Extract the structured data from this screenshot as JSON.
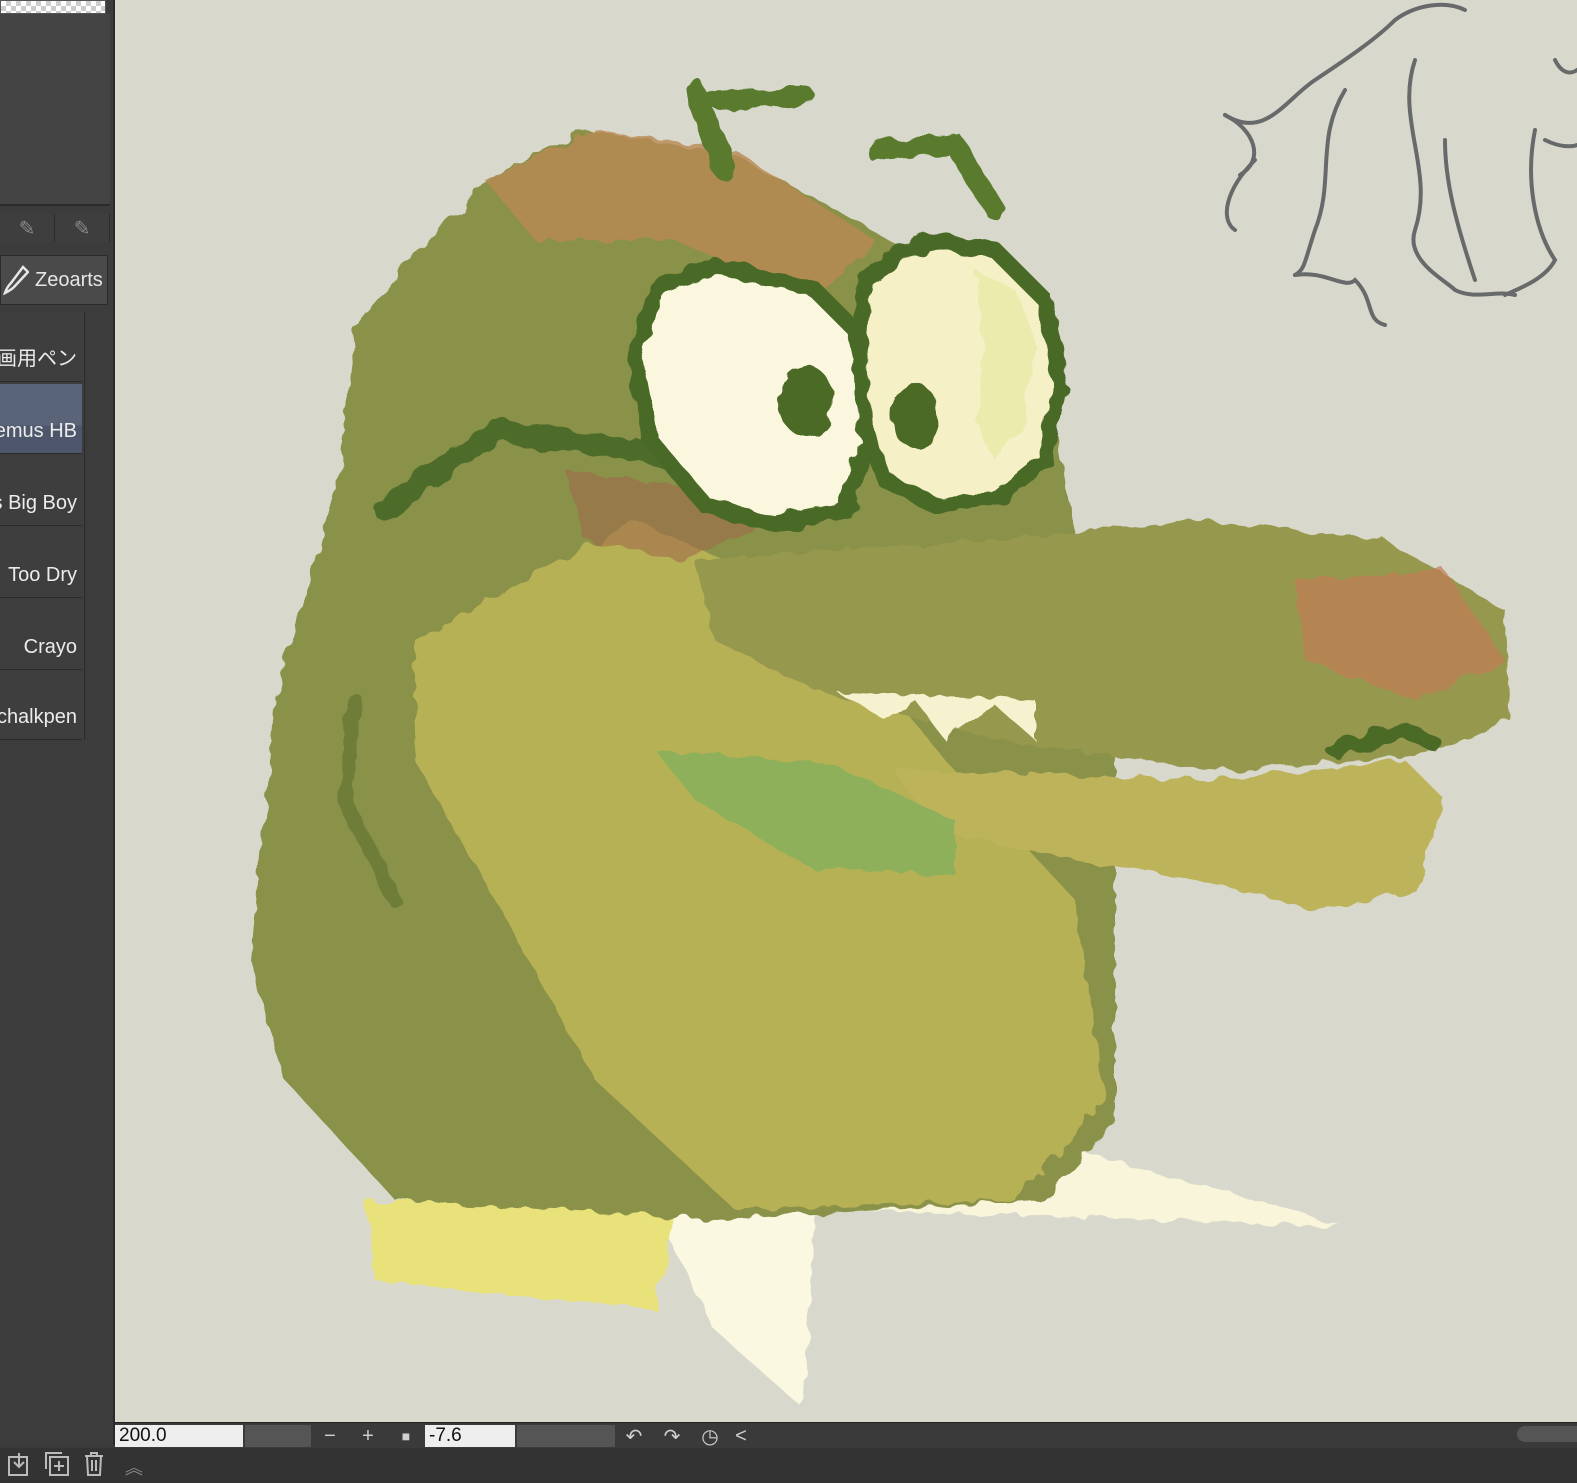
{
  "brush_set": {
    "label": "Zeoarts"
  },
  "brush_list": {
    "items": [
      {
        "label": "画用ペン",
        "selected": false
      },
      {
        "label": "emus HB",
        "selected": true
      },
      {
        "label": "s Big Boy",
        "selected": false
      },
      {
        "label": "Too Dry",
        "selected": false
      },
      {
        "label": "Crayo",
        "selected": false
      },
      {
        "label": "chalkpen",
        "selected": false
      }
    ]
  },
  "statusbar": {
    "zoom_value": "200.0",
    "rotation_value": "-7.6",
    "zoom_out_label": "−",
    "zoom_in_label": "+",
    "fit_label": "■",
    "collapse_label": "<"
  },
  "colors": {
    "canvas_bg": "#d8d9cc",
    "selection": "#5a6478",
    "panel_bg": "#3c3c3c"
  }
}
